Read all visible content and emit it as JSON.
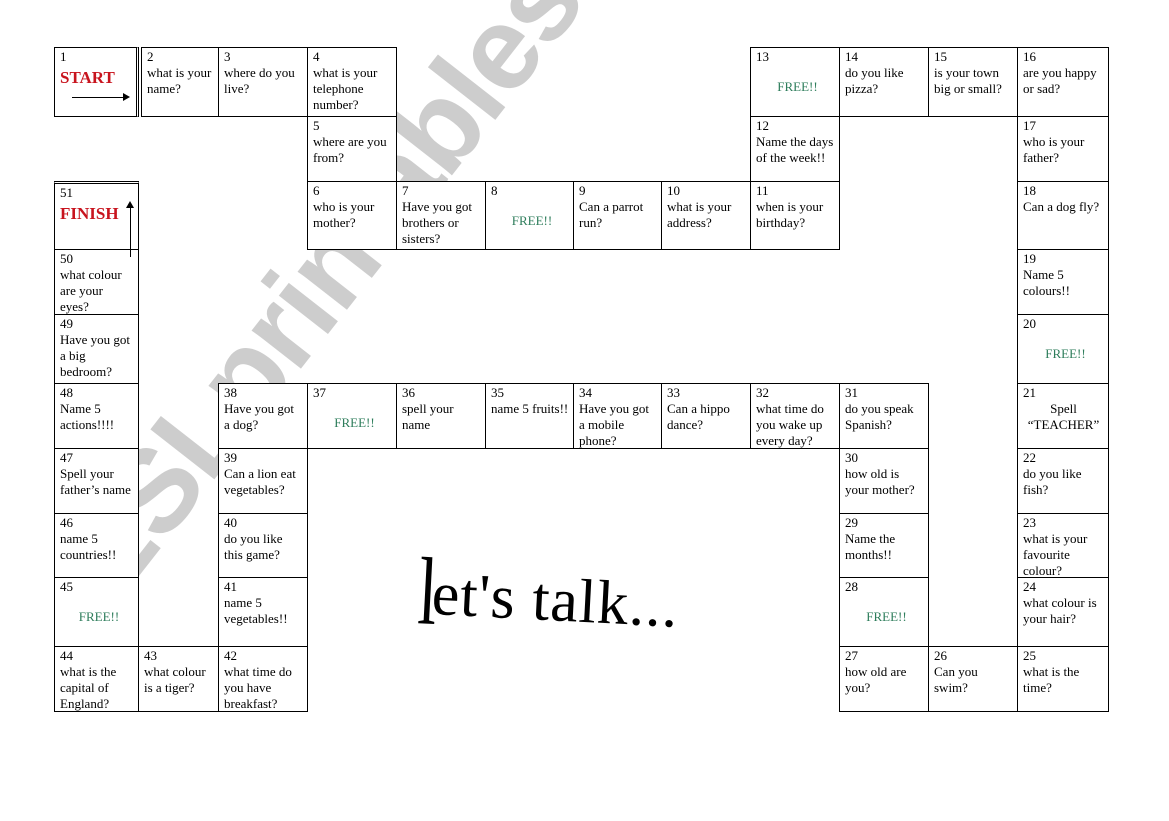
{
  "watermark": "ESLprintables.com",
  "title": {
    "first_letter": "l",
    "rest": "et's talk..."
  },
  "colors": {
    "start_finish": "#c8141e",
    "free": "#2e7d5b",
    "watermark": "#c8c8c8"
  },
  "cells": [
    {
      "n": "1",
      "special": "START"
    },
    {
      "n": "2",
      "text": "what is your name?"
    },
    {
      "n": "3",
      "text": "where do you live?"
    },
    {
      "n": "4",
      "text": "what is your telephone number?"
    },
    {
      "n": "5",
      "text": "where are you from?"
    },
    {
      "n": "6",
      "text": "who is your mother?"
    },
    {
      "n": "7",
      "text": "Have you got brothers or sisters?"
    },
    {
      "n": "8",
      "free": "FREE!!"
    },
    {
      "n": "9",
      "text": "Can a parrot run?"
    },
    {
      "n": "10",
      "text": "what is your address?"
    },
    {
      "n": "11",
      "text": "when is your birthday?"
    },
    {
      "n": "12",
      "text": "Name the days of the week!!"
    },
    {
      "n": "13",
      "free": "FREE!!"
    },
    {
      "n": "14",
      "text": "do you like pizza?"
    },
    {
      "n": "15",
      "text": "is your town big or small?"
    },
    {
      "n": "16",
      "text": "are you happy or sad?"
    },
    {
      "n": "17",
      "text": "who is your father?"
    },
    {
      "n": "18",
      "text": "Can a dog fly?"
    },
    {
      "n": "19",
      "text": "Name 5 colours!!"
    },
    {
      "n": "20",
      "free": "FREE!!"
    },
    {
      "n": "21",
      "center": "Spell “TEACHER”"
    },
    {
      "n": "22",
      "text": "do you like fish?"
    },
    {
      "n": "23",
      "text": "what is your favourite colour?"
    },
    {
      "n": "24",
      "text": "what colour is your hair?"
    },
    {
      "n": "25",
      "text": "what is the time?"
    },
    {
      "n": "26",
      "text": "Can you swim?"
    },
    {
      "n": "27",
      "text": "how old are you?"
    },
    {
      "n": "28",
      "free": "FREE!!"
    },
    {
      "n": "29",
      "text": "Name the months!!"
    },
    {
      "n": "30",
      "text": "how old is your mother?"
    },
    {
      "n": "31",
      "text": "do you speak Spanish?"
    },
    {
      "n": "32",
      "text": "what time do you wake up every day?"
    },
    {
      "n": "33",
      "text": "Can a hippo dance?"
    },
    {
      "n": "34",
      "text": "Have you got a mobile phone?"
    },
    {
      "n": "35",
      "text": "name 5 fruits!!"
    },
    {
      "n": "36",
      "text": "spell your name"
    },
    {
      "n": "37",
      "free": "FREE!!"
    },
    {
      "n": "38",
      "text": "Have you got a dog?"
    },
    {
      "n": "39",
      "text": "Can a lion eat vegetables?"
    },
    {
      "n": "40",
      "text": "do you like this game?"
    },
    {
      "n": "41",
      "text": "name 5 vegetables!!"
    },
    {
      "n": "42",
      "text": "what time do you have breakfast?"
    },
    {
      "n": "43",
      "text": "what colour is a tiger?"
    },
    {
      "n": "44",
      "text": "what is the capital of England?"
    },
    {
      "n": "45",
      "free": "FREE!!"
    },
    {
      "n": "46",
      "text": "name 5 countries!!"
    },
    {
      "n": "47",
      "text": "Spell your father’s name"
    },
    {
      "n": "48",
      "text": "Name 5 actions!!!!"
    },
    {
      "n": "49",
      "text": "Have you got a big bedroom?"
    },
    {
      "n": "50",
      "text": "what colour are your eyes?"
    },
    {
      "n": "51",
      "special": "FINISH"
    }
  ]
}
